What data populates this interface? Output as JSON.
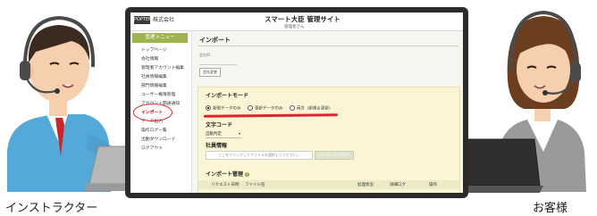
{
  "people": {
    "instructor_label": "インストラクター",
    "customer_label": "お客様"
  },
  "app": {
    "company_logo": "POPTEM",
    "company_name": "株式会社",
    "site_title": "スマート大臣 管理サイト",
    "user_line": "管理者さん"
  },
  "sidebar": {
    "header": "管理メニュー",
    "items": [
      {
        "label": "トップページ"
      },
      {
        "label": "会社情報"
      },
      {
        "label": "管理者アカウント編集"
      },
      {
        "label": "社員情報編集"
      },
      {
        "label": "部門情報編集"
      },
      {
        "label": "ユーザー権限管理"
      },
      {
        "label": "アカウント開通通知"
      },
      {
        "label": "インポート"
      },
      {
        "label": "データ出力"
      },
      {
        "label": "操作ログ一覧"
      },
      {
        "label": "出勤ダウンロード"
      },
      {
        "label": "ログアウト"
      }
    ]
  },
  "main": {
    "page_title": "インポート",
    "field_label": "会社ID",
    "company_button": "会社変更",
    "import_mode_title": "インポートモード",
    "radio_options": [
      {
        "label": "新規データのみ",
        "selected": true
      },
      {
        "label": "更新データのみ",
        "selected": false
      },
      {
        "label": "両方（新規＆更新）",
        "selected": false
      }
    ],
    "char_code_title": "文字コード",
    "char_code_value": "自動判定",
    "employee_info_title": "社員情報",
    "file_placeholder": "ここをクリックしてファイルを選択してください。",
    "upload_button": "インポートボタン",
    "import_manage_title": "インポート管理",
    "table_headers": [
      "リクエスト日時",
      "ファイル名",
      "処理状況",
      "詳細ログ",
      "操作"
    ]
  },
  "colors": {
    "sidebar_header": "#9eb34f",
    "panel_bg": "#fbf5d6",
    "annotation_red": "#e0242f",
    "help_green": "#7aa233"
  }
}
